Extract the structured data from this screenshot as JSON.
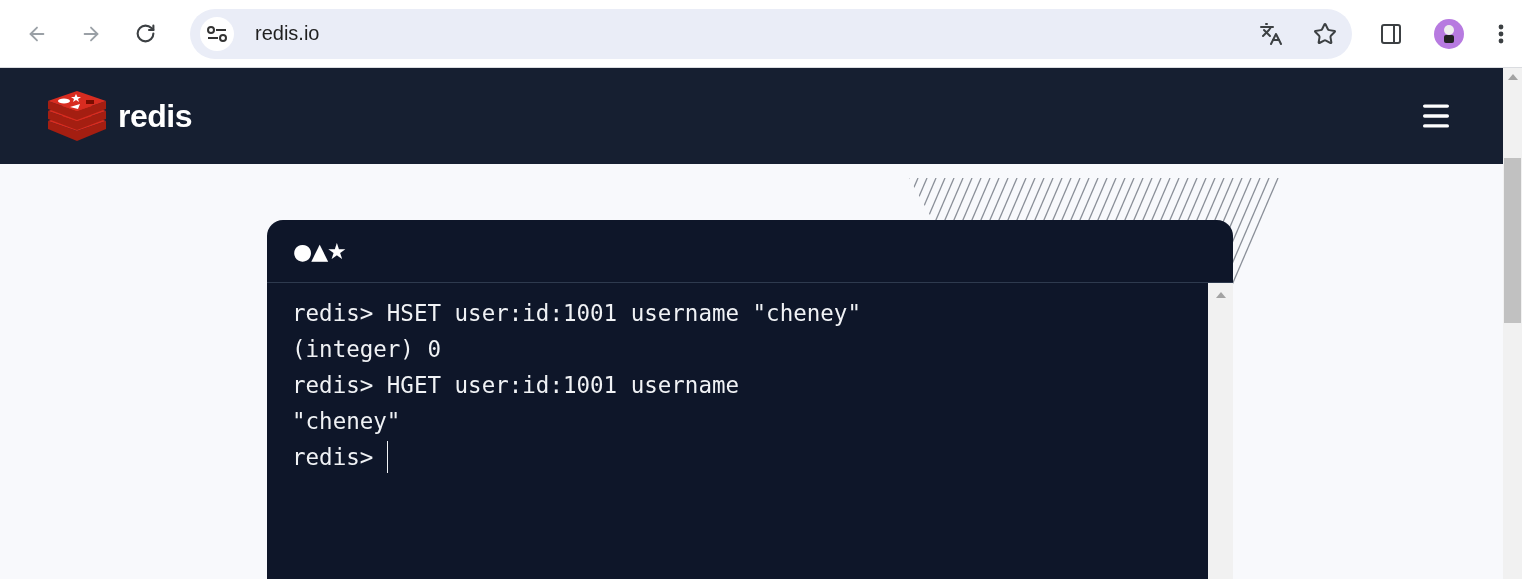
{
  "browser": {
    "back_disabled": true,
    "forward_disabled": true,
    "address": "redis.io",
    "bookmarked": false
  },
  "site_nav": {
    "brand": "redis"
  },
  "terminal": {
    "header_glyphs": "●▲★",
    "lines": [
      "redis> HSET user:id:1001 username \"cheney\"",
      "(integer) 0",
      "redis> HGET user:id:1001 username",
      "\"cheney\""
    ],
    "prompt": "redis>",
    "cursor_visible": true
  }
}
